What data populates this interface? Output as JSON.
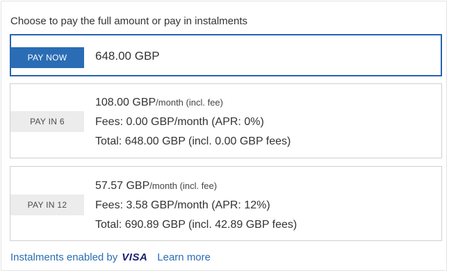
{
  "heading": "Choose to pay the full amount or pay in instalments",
  "options": [
    {
      "tag": "PAY NOW",
      "selected": true,
      "amount": "648.00 GBP"
    },
    {
      "tag": "PAY IN 6",
      "selected": false,
      "amount": "108.00 GBP",
      "unit": "/month (incl. fee)",
      "fees": "Fees: 0.00 GBP/month (APR: 0%)",
      "total": "Total: 648.00 GBP (incl. 0.00 GBP fees)"
    },
    {
      "tag": "PAY IN 12",
      "selected": false,
      "amount": "57.57 GBP",
      "unit": "/month (incl. fee)",
      "fees": "Fees: 3.58 GBP/month (APR: 12%)",
      "total": "Total: 690.89 GBP (incl. 42.89 GBP fees)"
    }
  ],
  "footer": {
    "enabled_by": "Instalments enabled by",
    "brand": "VISA",
    "learn_more": "Learn more"
  },
  "colors": {
    "accent": "#2a6db5",
    "selected_border": "#2463b3",
    "tag_bg": "#ececec",
    "visa": "#1a1f71"
  }
}
